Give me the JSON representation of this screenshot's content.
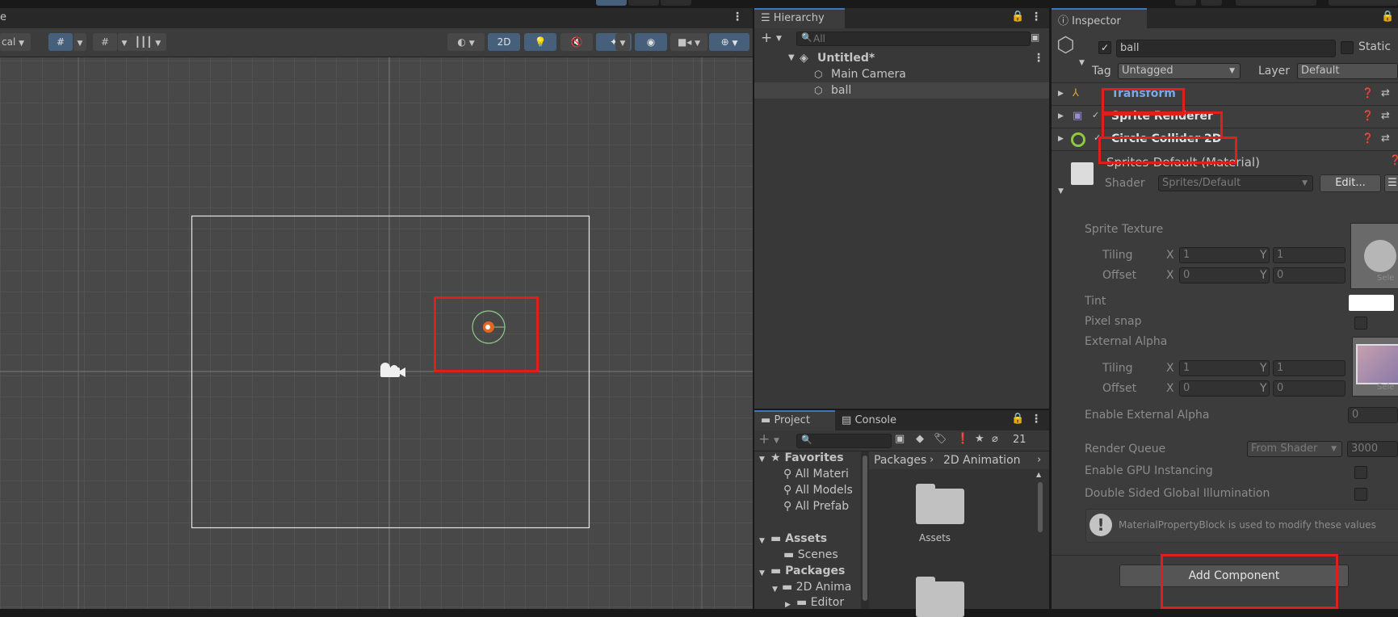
{
  "scene": {
    "tab_fragment": "e",
    "toolbar": {
      "left_dropdown": "cal",
      "mode_2d": "2D"
    }
  },
  "hierarchy": {
    "tab": "Hierarchy",
    "search_placeholder": "All",
    "scene_name": "Untitled*",
    "items": [
      "Main Camera",
      "ball"
    ]
  },
  "project": {
    "tabs": [
      "Project",
      "Console"
    ],
    "hidden_count": "21",
    "favorites_label": "Favorites",
    "favorites": [
      "All Materi",
      "All Models",
      "All Prefab"
    ],
    "assets_label": "Assets",
    "assets_children": [
      "Scenes"
    ],
    "packages_label": "Packages",
    "packages_children": [
      "2D Anima"
    ],
    "packages_grandchildren": [
      "Editor"
    ],
    "breadcrumb": [
      "Packages",
      "2D Animation"
    ],
    "grid_items": [
      "Assets"
    ]
  },
  "inspector": {
    "tab": "Inspector",
    "object_name": "ball",
    "static_label": "Static",
    "tag_label": "Tag",
    "tag_value": "Untagged",
    "layer_label": "Layer",
    "layer_value": "Default",
    "components": [
      "Transform",
      "Sprite Renderer",
      "Circle Collider 2D"
    ],
    "material": {
      "name": "Sprites-Default (Material)",
      "shader_label": "Shader",
      "shader_value": "Sprites/Default",
      "edit_button": "Edit...",
      "sprite_texture": "Sprite Texture",
      "tiling": "Tiling",
      "offset": "Offset",
      "x": "X",
      "y": "Y",
      "tiling1": [
        "1",
        "1"
      ],
      "offset1": [
        "0",
        "0"
      ],
      "tint": "Tint",
      "pixel_snap": "Pixel snap",
      "external_alpha": "External Alpha",
      "tiling2": [
        "1",
        "1"
      ],
      "offset2": [
        "0",
        "0"
      ],
      "select_fragment": "Sele",
      "enable_external_alpha": "Enable External Alpha",
      "enable_external_alpha_value": "0",
      "render_queue": "Render Queue",
      "render_queue_mode": "From Shader",
      "render_queue_value": "3000",
      "gpu_instancing": "Enable GPU Instancing",
      "double_sided_gi": "Double Sided Global Illumination",
      "info_message": "MaterialPropertyBlock is used to modify these values"
    },
    "add_component": "Add Component"
  },
  "colors": {
    "highlight_red": "#e01e1e",
    "selection_blue": "#46607c",
    "collider_green": "#8ec98e",
    "transform_link": "#79a9e9"
  }
}
